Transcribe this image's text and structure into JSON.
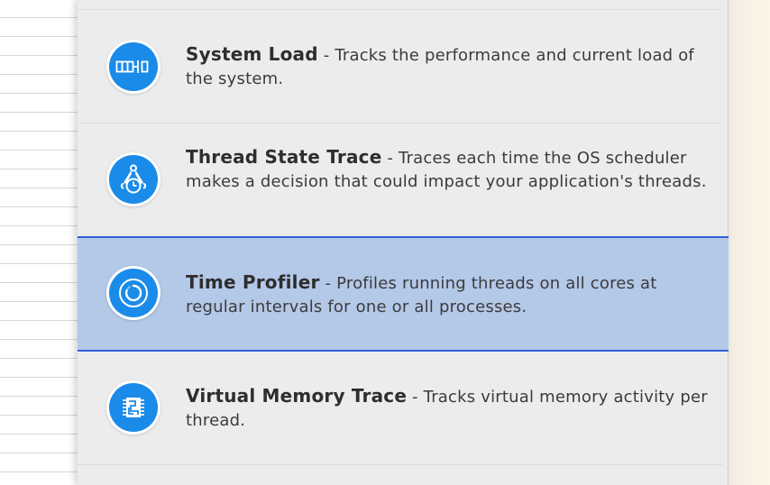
{
  "instruments": [
    {
      "title": "System Load",
      "separator": " - ",
      "description": "Tracks the performance and current load of the system.",
      "icon": "system-load-icon"
    },
    {
      "title": "Thread State Trace",
      "separator": " - ",
      "description": "Traces each time the OS scheduler makes a decision that could impact your application's threads.",
      "icon": "thread-state-trace-icon"
    },
    {
      "title": "Time Profiler",
      "separator": " - ",
      "description": "Profiles running threads on all cores at regular intervals for one or all processes.",
      "icon": "time-profiler-icon",
      "selected": true
    },
    {
      "title": "Virtual Memory Trace",
      "separator": " - ",
      "description": "Tracks virtual memory activity per thread.",
      "icon": "virtual-memory-trace-icon"
    }
  ],
  "colors": {
    "icon_blue": "#1a8be9",
    "selection_fill": "#b4c8e8",
    "selection_border": "#2f62d9"
  }
}
